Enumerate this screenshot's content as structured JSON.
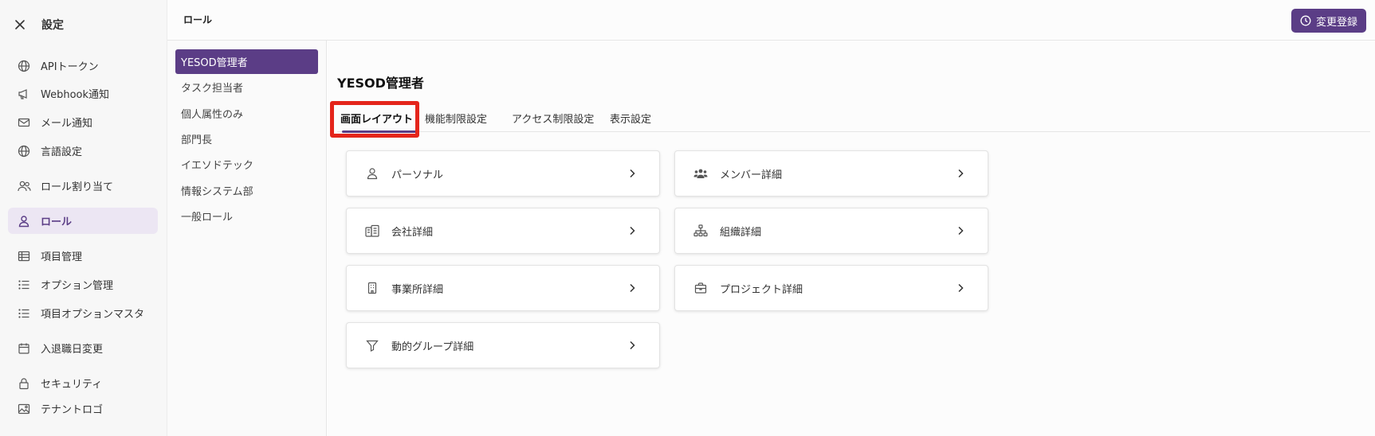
{
  "sidebar": {
    "title": "設定",
    "close_icon": "close-icon",
    "items": [
      {
        "label": "APIトークン",
        "icon": "globe-icon"
      },
      {
        "label": "Webhook通知",
        "icon": "megaphone-icon"
      },
      {
        "label": "メール通知",
        "icon": "mail-icon"
      },
      {
        "label": "言語設定",
        "icon": "globe-icon"
      },
      {
        "label": "ロール割り当て",
        "icon": "users-icon"
      },
      {
        "label": "ロール",
        "icon": "user-icon",
        "active": true
      },
      {
        "label": "項目管理",
        "icon": "table-icon"
      },
      {
        "label": "オプション管理",
        "icon": "list-icon"
      },
      {
        "label": "項目オプションマスタ",
        "icon": "list-icon"
      },
      {
        "label": "入退職日変更",
        "icon": "calendar-icon"
      },
      {
        "label": "セキュリティ",
        "icon": "lock-icon"
      },
      {
        "label": "テナントロゴ",
        "icon": "image-icon"
      }
    ]
  },
  "header": {
    "breadcrumb": "ロール",
    "submit_label": "変更登録",
    "submit_icon": "clock-icon"
  },
  "roles": {
    "items": [
      "YESOD管理者",
      "タスク担当者",
      "個人属性のみ",
      "部門長",
      "イエソドテック",
      "情報システム部",
      "一般ロール"
    ],
    "selected": "YESOD管理者"
  },
  "main": {
    "title": "YESOD管理者",
    "tabs": [
      {
        "label": "画面レイアウト",
        "active": true
      },
      {
        "label": "機能制限設定"
      },
      {
        "label": "アクセス制限設定"
      },
      {
        "label": "表示設定"
      }
    ],
    "cards": [
      {
        "label": "パーソナル",
        "icon": "user-icon"
      },
      {
        "label": "メンバー詳細",
        "icon": "group-icon"
      },
      {
        "label": "会社詳細",
        "icon": "buildings-icon"
      },
      {
        "label": "組織詳細",
        "icon": "org-chart-icon"
      },
      {
        "label": "事業所詳細",
        "icon": "building-icon"
      },
      {
        "label": "プロジェクト詳細",
        "icon": "briefcase-icon"
      },
      {
        "label": "動的グループ詳細",
        "icon": "filter-icon"
      }
    ]
  },
  "colors": {
    "accent": "#5b3d86",
    "highlight": "#e4251b",
    "active_bg": "#ece6f3"
  }
}
